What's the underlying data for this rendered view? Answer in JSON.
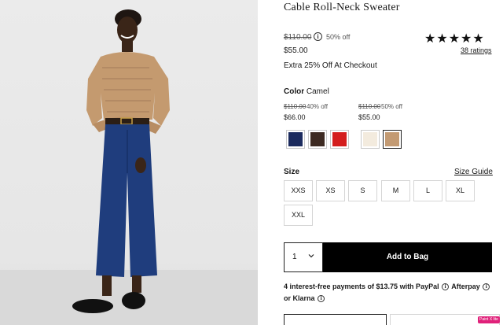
{
  "product": {
    "title": "Cable Roll-Neck Sweater",
    "original_price": "$110.00",
    "percent_off": "50% off",
    "sale_price": "$55.00",
    "promo": "Extra 25% Off At Checkout",
    "rating_stars": "★★★★★",
    "ratings_link": "38 ratings"
  },
  "color": {
    "label": "Color",
    "selected": "Camel",
    "groups": [
      {
        "original": "$110.00",
        "percent": "40% off",
        "price": "$66.00"
      },
      {
        "original": "$110.00",
        "percent": "50% off",
        "price": "$55.00"
      }
    ],
    "swatches": [
      {
        "name": "navy",
        "hex": "#1c2b5e"
      },
      {
        "name": "brown",
        "hex": "#3d2a22"
      },
      {
        "name": "red",
        "hex": "#d41e1e"
      },
      {
        "name": "ivory",
        "hex": "#f3ebde"
      },
      {
        "name": "camel",
        "hex": "#c39a72"
      }
    ]
  },
  "size": {
    "label": "Size",
    "guide": "Size Guide",
    "options": [
      "XXS",
      "XS",
      "S",
      "M",
      "L",
      "XL",
      "XXL"
    ]
  },
  "purchase": {
    "quantity": "1",
    "add_to_bag": "Add to Bag"
  },
  "payment": {
    "line1": "4 interest-free payments of $13.75 with PayPal",
    "afterpay": "Afterpay",
    "or": "or",
    "klarna": "Klarna"
  },
  "badge": "Paint X lite"
}
